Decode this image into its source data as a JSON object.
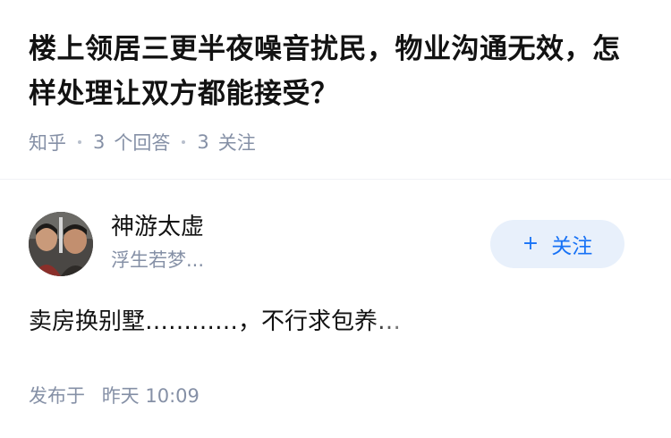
{
  "question": {
    "title": "楼上领居三更半夜噪音扰民，物业沟通无效，怎样处理让双方都能接受？",
    "source": "知乎",
    "answer_count": "3",
    "answer_label": "个回答",
    "follow_count": "3",
    "follow_label": "关注"
  },
  "answer": {
    "author_name": "神游太虚",
    "author_bio": "浮生若梦...",
    "follow_button": {
      "icon": "plus-icon",
      "label": "关注"
    },
    "content": "卖房换别墅…………，不行求包养…",
    "time_prefix": "发布于",
    "time": "昨天 10:09"
  },
  "colors": {
    "primary_text": "#121212",
    "meta_text": "#8590a6",
    "follow_blue": "#1772f6",
    "follow_bg": "#e8f0fb"
  }
}
